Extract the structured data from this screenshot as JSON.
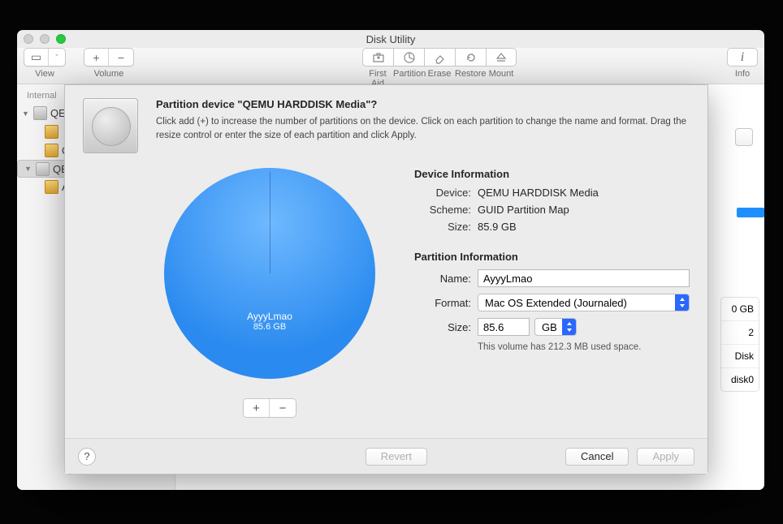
{
  "window": {
    "title": "Disk Utility"
  },
  "toolbar": {
    "view": "View",
    "volume": "Volume",
    "firstaid": "First Aid",
    "partition": "Partition",
    "erase": "Erase",
    "restore": "Restore",
    "mount": "Mount",
    "info": "Info"
  },
  "sidebar": {
    "header": "Internal",
    "items": [
      {
        "label": "QE"
      },
      {
        "label": ""
      },
      {
        "label": "QE"
      },
      {
        "label": "QE"
      },
      {
        "label": "A"
      }
    ]
  },
  "background": {
    "capacity": "0 GB",
    "partitions": "2",
    "type": "Disk",
    "node": "disk0"
  },
  "sheet": {
    "title": "Partition device \"QEMU HARDDISK Media\"?",
    "desc": "Click add (+) to increase the number of partitions on the device. Click on each partition to change the name and format. Drag the resize control or enter the size of each partition and click Apply.",
    "pie": {
      "name": "AyyyLmao",
      "size": "85.6 GB"
    },
    "device_header": "Device Information",
    "device": {
      "device_k": "Device:",
      "device_v": "QEMU HARDDISK Media",
      "scheme_k": "Scheme:",
      "scheme_v": "GUID Partition Map",
      "size_k": "Size:",
      "size_v": "85.9 GB"
    },
    "partition_header": "Partition Information",
    "form": {
      "name_k": "Name:",
      "name_v": "AyyyLmao",
      "format_k": "Format:",
      "format_v": "Mac OS Extended (Journaled)",
      "size_k": "Size:",
      "size_v": "85.6",
      "size_unit": "GB",
      "hint": "This volume has 212.3 MB used space."
    },
    "buttons": {
      "revert": "Revert",
      "cancel": "Cancel",
      "apply": "Apply"
    }
  },
  "chart_data": {
    "type": "pie",
    "title": "",
    "series": [
      {
        "name": "AyyyLmao",
        "values": [
          85.6
        ]
      }
    ],
    "total": 85.6,
    "unit": "GB"
  }
}
